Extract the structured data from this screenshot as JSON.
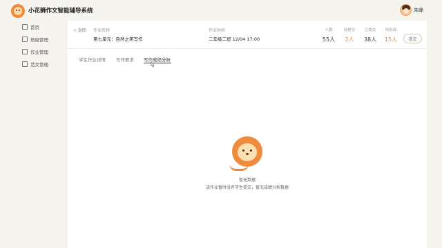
{
  "header": {
    "app_title": "小花狮作文智能辅导系统",
    "user_name": "朱峰"
  },
  "sidebar": {
    "items": [
      {
        "label": "首页",
        "icon": "home-icon"
      },
      {
        "label": "班级管理",
        "icon": "class-icon"
      },
      {
        "label": "作业管理",
        "icon": "homework-icon"
      },
      {
        "label": "范文管理",
        "icon": "essay-icon"
      }
    ]
  },
  "assignment": {
    "back_label": "< 返回",
    "name_label": "作业名称",
    "name_value": "第七单元：自然之美写作",
    "date_label": "作业时间",
    "date_value": "二年级二班 12/04 17:00",
    "stats": [
      {
        "label": "人数",
        "value": "55人",
        "color": "#333333"
      },
      {
        "label": "待提交",
        "value": "2人",
        "color": "#e8842f"
      },
      {
        "label": "已提交",
        "value": "38人",
        "color": "#333333"
      },
      {
        "label": "待批改",
        "value": "15人",
        "color": "#e8842f"
      }
    ],
    "action_label": "提交"
  },
  "tabs": [
    {
      "label": "学生作业详情",
      "active": false
    },
    {
      "label": "写作要求",
      "active": false
    },
    {
      "label": "写作成绩分析",
      "active": true
    }
  ],
  "empty_state": {
    "title": "暂无数据",
    "description": "该作业暂时没有学生提交，暂无成绩分析数据"
  },
  "colors": {
    "accent": "#ef8b3c",
    "background": "#f6f4ef"
  }
}
